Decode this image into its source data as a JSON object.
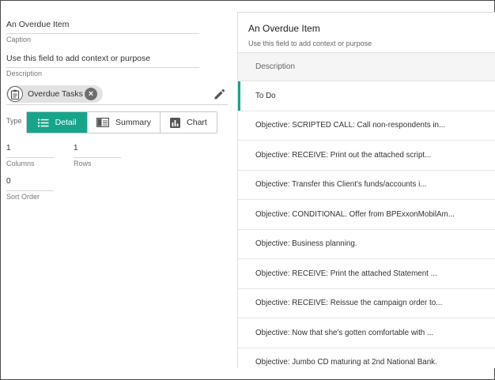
{
  "left": {
    "caption": {
      "value": "An Overdue Item",
      "label": "Caption"
    },
    "description": {
      "value": "Use this field to add context or purpose",
      "label": "Description"
    },
    "chip": {
      "label": "Overdue Tasks"
    },
    "type": {
      "label": "Type",
      "options": [
        {
          "label": "Detail",
          "active": true
        },
        {
          "label": "Summary",
          "active": false
        },
        {
          "label": "Chart",
          "active": false
        }
      ]
    },
    "columns": {
      "value": "1",
      "label": "Columns"
    },
    "rows": {
      "value": "1",
      "label": "Rows"
    },
    "sort_order": {
      "value": "0",
      "label": "Sort Order"
    }
  },
  "preview": {
    "title": "An Overdue Item",
    "subtitle": "Use this field to add context or purpose",
    "column_header": "Description",
    "rows": [
      "To Do",
      "Objective: SCRIPTED CALL: Call non-respondents in...",
      "Objective: RECEIVE: Print out the attached script...",
      "Objective: Transfer this Client's funds/accounts i...",
      "Objective: CONDITIONAL. Offer from BPExxonMobilAm...",
      "Objective: Business planning.",
      "Objective: RECEIVE: Print the attached Statement ...",
      "Objective: RECEIVE: Reissue the campaign order to...",
      "Objective: Now that she's gotten comfortable with ...",
      "Objective: Jumbo CD maturing at 2nd National Bank."
    ]
  },
  "colors": {
    "accent": "#16a58a",
    "chip_bg": "#e2e2e2"
  }
}
